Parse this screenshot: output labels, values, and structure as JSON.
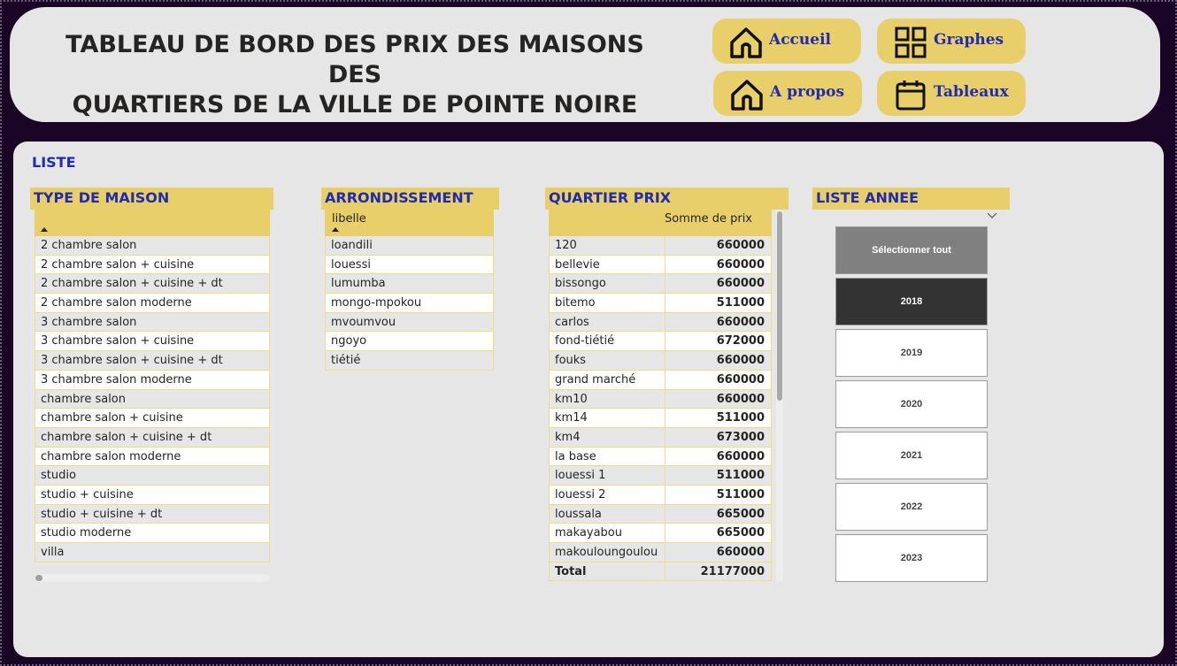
{
  "header": {
    "title_line1": "TABLEAU DE BORD DES PRIX DES MAISONS DES",
    "title_line2": "QUARTIERS DE LA VILLE DE POINTE NOIRE",
    "nav": [
      {
        "label": "Accueil",
        "icon": "home-icon"
      },
      {
        "label": "Graphes",
        "icon": "grid-icon"
      },
      {
        "label": "A propos",
        "icon": "home-icon"
      },
      {
        "label": "Tableaux",
        "icon": "calendar-icon"
      }
    ]
  },
  "colors": {
    "background": "#1a0527",
    "panel": "#e6e6e6",
    "accent": "#e8cf6a",
    "title_blue": "#1f2bb0"
  },
  "main": {
    "section_title": "LISTE",
    "type_maison": {
      "heading": "TYPE DE MAISON",
      "rows": [
        "2 chambre salon",
        "2 chambre salon + cuisine",
        "2 chambre salon + cuisine + dt",
        "2 chambre salon moderne",
        "3 chambre salon",
        "3 chambre salon + cuisine",
        "3 chambre salon + cuisine + dt",
        "3 chambre salon moderne",
        "chambre salon",
        "chambre salon + cuisine",
        "chambre salon + cuisine + dt",
        "chambre salon moderne",
        "studio",
        "studio + cuisine",
        "studio + cuisine + dt",
        "studio moderne",
        "villa"
      ]
    },
    "arrondissement": {
      "heading": "ARRONDISSEMENT",
      "column": "libelle",
      "rows": [
        "loandili",
        "louessi",
        "lumumba",
        "mongo-mpokou",
        "mvoumvou",
        "ngoyo",
        "tiétié"
      ]
    },
    "quartier_prix": {
      "heading": "QUARTIER PRIX",
      "column_value": "Somme de prix",
      "rows": [
        {
          "name": "120",
          "value": "660000"
        },
        {
          "name": "bellevie",
          "value": "660000"
        },
        {
          "name": "bissongo",
          "value": "660000"
        },
        {
          "name": "bitemo",
          "value": "511000"
        },
        {
          "name": "carlos",
          "value": "660000"
        },
        {
          "name": "fond-tiétié",
          "value": "672000"
        },
        {
          "name": "fouks",
          "value": "660000"
        },
        {
          "name": "grand marché",
          "value": "660000"
        },
        {
          "name": "km10",
          "value": "660000"
        },
        {
          "name": "km14",
          "value": "511000"
        },
        {
          "name": "km4",
          "value": "673000"
        },
        {
          "name": "la base",
          "value": "660000"
        },
        {
          "name": "louessi 1",
          "value": "511000"
        },
        {
          "name": "louessi 2",
          "value": "511000"
        },
        {
          "name": "loussala",
          "value": "665000"
        },
        {
          "name": "makayabou",
          "value": "665000"
        },
        {
          "name": "makouloungoulou",
          "value": "660000"
        }
      ],
      "total_label": "Total",
      "total_value": "21177000"
    },
    "liste_annee": {
      "heading": "LISTE ANNEE",
      "select_all": "Sélectionner tout",
      "years": [
        "2018",
        "2019",
        "2020",
        "2021",
        "2022",
        "2023"
      ],
      "selected": "2018"
    }
  }
}
